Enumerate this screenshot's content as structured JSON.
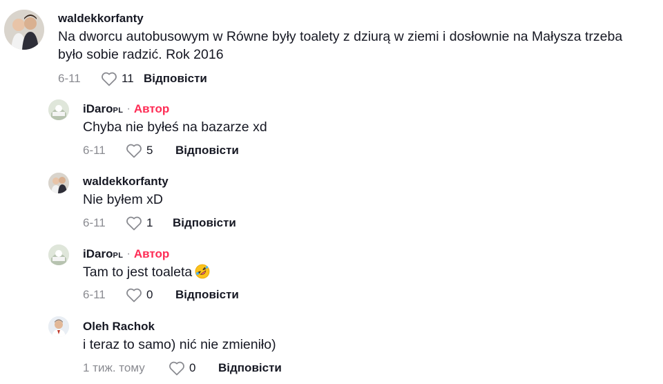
{
  "comments": [
    {
      "username": "waldekkorfanty",
      "text": "Na dworcu autobusowym w Równe były toalety z dziurą w ziemi i dosłownie na Małysza trzeba było sobie radzić. Rok 2016",
      "time": "6-11",
      "likes": "11",
      "reply_label": "Відповісти"
    },
    {
      "username": "iDaro",
      "username_suffix": "PL",
      "separator": "·",
      "author_label": "Автор",
      "text": "Chyba nie byłeś na bazarze xd",
      "time": "6-11",
      "likes": "5",
      "reply_label": "Відповісти"
    },
    {
      "username": "waldekkorfanty",
      "text": "Nie byłem xD",
      "time": "6-11",
      "likes": "1",
      "reply_label": "Відповісти"
    },
    {
      "username": "iDaro",
      "username_suffix": "PL",
      "separator": "·",
      "author_label": "Автор",
      "text": "Tam to jest toaleta",
      "emoji": "rolling-on-floor-laughing",
      "time": "6-11",
      "likes": "0",
      "reply_label": "Відповісти"
    },
    {
      "username": "Oleh Rachok",
      "text": "i teraz to samo) nić nie zmieniło)",
      "time": "1 тиж. тому",
      "likes": "0",
      "reply_label": "Відповісти"
    }
  ],
  "colors": {
    "author": "#fe2c55",
    "meta": "#8a8b91",
    "text": "#161823"
  },
  "icons": {
    "like": "heart-outline-icon",
    "emoji": "rolling-laughing-emoji-icon"
  }
}
